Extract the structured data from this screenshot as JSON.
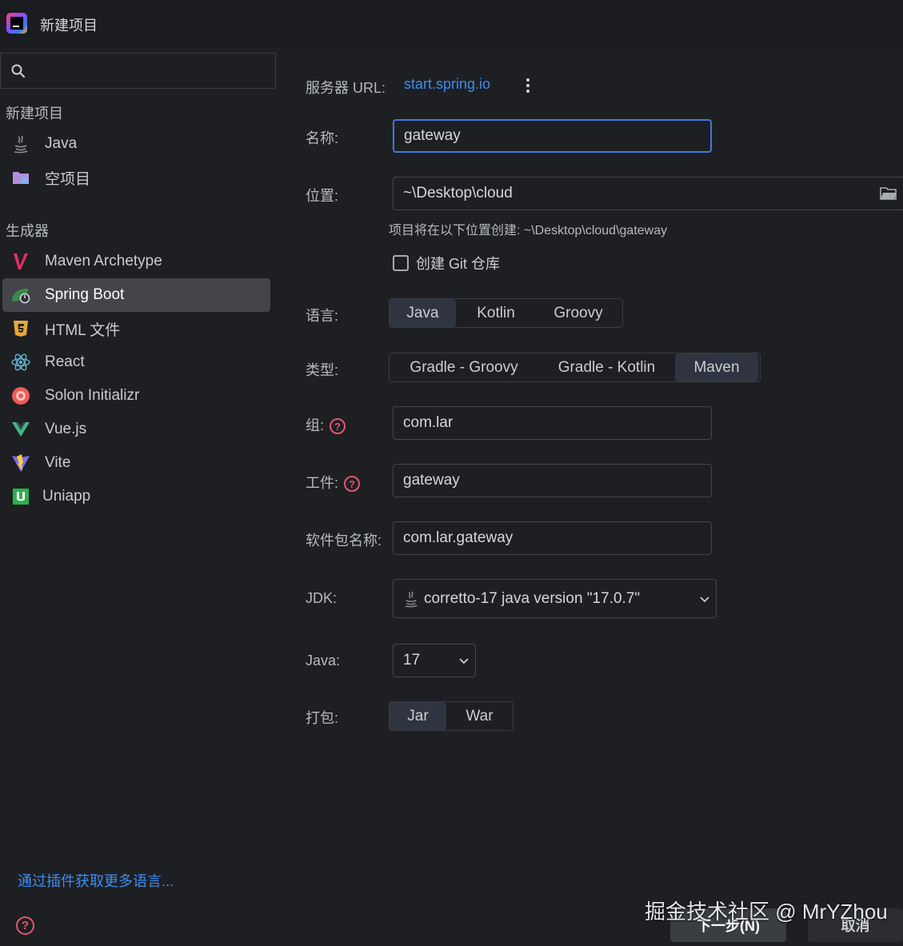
{
  "window": {
    "title": "新建项目"
  },
  "sidebar": {
    "search": {
      "value": ""
    },
    "section_new": "新建项目",
    "new_items": [
      {
        "label": "Java",
        "icon": "java-icon"
      },
      {
        "label": "空项目",
        "icon": "empty-project-icon"
      }
    ],
    "section_generators": "生成器",
    "generators": [
      {
        "label": "Maven Archetype",
        "icon": "maven-icon",
        "selected": false
      },
      {
        "label": "Spring Boot",
        "icon": "spring-boot-icon",
        "selected": true
      },
      {
        "label": "HTML 文件",
        "icon": "html5-icon",
        "selected": false
      },
      {
        "label": "React",
        "icon": "react-icon",
        "selected": false
      },
      {
        "label": "Solon Initializr",
        "icon": "solon-icon",
        "selected": false
      },
      {
        "label": "Vue.js",
        "icon": "vue-icon",
        "selected": false
      },
      {
        "label": "Vite",
        "icon": "vite-icon",
        "selected": false
      },
      {
        "label": "Uniapp",
        "icon": "uniapp-icon",
        "selected": false
      }
    ],
    "plugin_link": "通过插件获取更多语言..."
  },
  "form": {
    "server_url": {
      "label": "服务器 URL:",
      "value": "start.spring.io"
    },
    "name": {
      "label": "名称:",
      "value": "gateway"
    },
    "location": {
      "label": "位置:",
      "value": "~\\Desktop\\cloud",
      "hint": "项目将在以下位置创建: ~\\Desktop\\cloud\\gateway"
    },
    "git": {
      "label": "创建 Git 仓库",
      "checked": false
    },
    "language": {
      "label": "语言:",
      "options": [
        "Java",
        "Kotlin",
        "Groovy"
      ],
      "selected": "Java"
    },
    "type": {
      "label": "类型:",
      "options": [
        "Gradle - Groovy",
        "Gradle - Kotlin",
        "Maven"
      ],
      "selected": "Maven"
    },
    "group": {
      "label": "组:",
      "value": "com.lar"
    },
    "artifact": {
      "label": "工件:",
      "value": "gateway"
    },
    "package_name": {
      "label": "软件包名称:",
      "value": "com.lar.gateway"
    },
    "jdk": {
      "label": "JDK:",
      "value": "corretto-17 java version \"17.0.7\""
    },
    "java": {
      "label": "Java:",
      "value": "17"
    },
    "packaging": {
      "label": "打包:",
      "options": [
        "Jar",
        "War"
      ],
      "selected": "Jar"
    }
  },
  "footer": {
    "next_label": "下一步(N)",
    "cancel_label": "取消",
    "watermark": "掘金技术社区 @ MrYZhou"
  },
  "colors": {
    "background": "#1e1f22",
    "accent_link": "#3d8cf0",
    "focus_border": "#3d7ae0",
    "selected_item": "#43454a",
    "help_red": "#e55470"
  }
}
